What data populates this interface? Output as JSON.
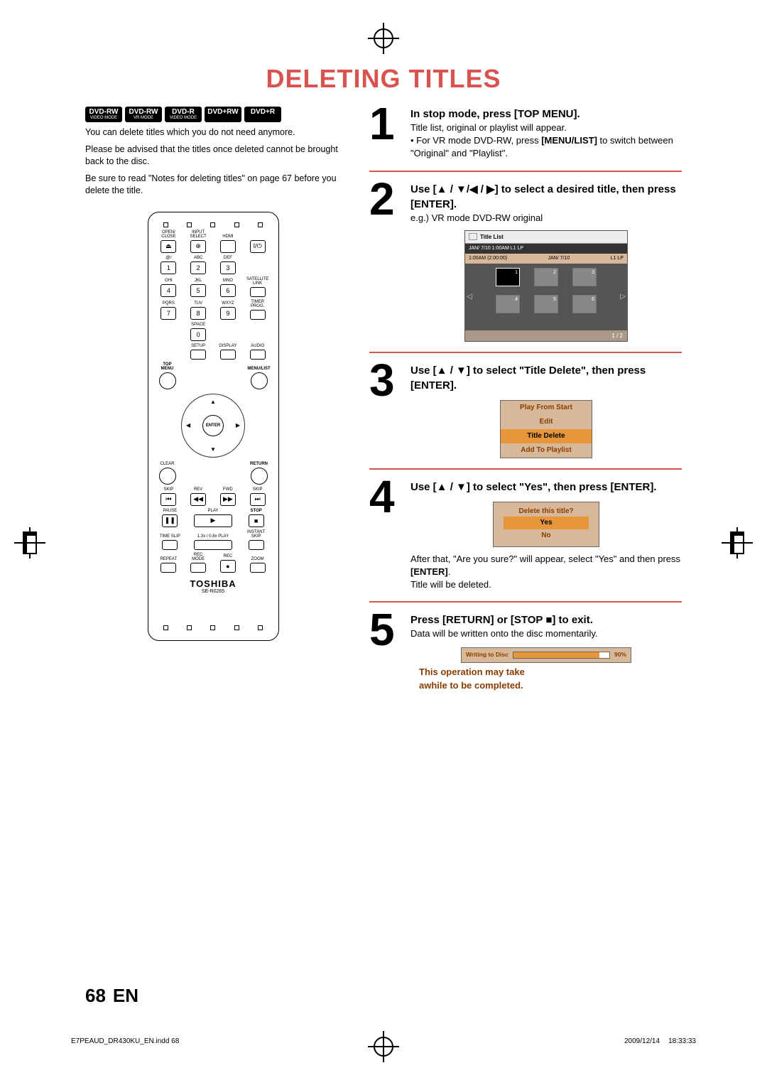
{
  "header": {
    "title": "DELETING TITLES"
  },
  "badges": [
    {
      "top": "DVD-RW",
      "bot": "VIDEO MODE"
    },
    {
      "top": "DVD-RW",
      "bot": "VR MODE"
    },
    {
      "top": "DVD-R",
      "bot": "VIDEO MODE"
    },
    {
      "top": "DVD+RW",
      "bot": ""
    },
    {
      "top": "DVD+R",
      "bot": ""
    }
  ],
  "intro": {
    "p1": "You can delete titles which you do not need anymore.",
    "p2": "Please be advised that the titles once deleted cannot be brought back to the disc.",
    "p3": "Be sure to read \"Notes for deleting titles\" on page 67 before you delete the title."
  },
  "remote": {
    "row1": [
      "OPEN/\nCLOSE",
      "INPUT\nSELECT",
      "HDMI",
      ""
    ],
    "numpad_labels": [
      ".@/:",
      "ABC",
      "DEF",
      "GHI",
      "JKL",
      "MNO",
      "PQRS",
      "TUV",
      "WXYZ",
      "",
      "SPACE",
      ""
    ],
    "numbers": [
      "1",
      "2",
      "3",
      "4",
      "5",
      "6",
      "7",
      "8",
      "9",
      "",
      "0",
      ""
    ],
    "side_labels": [
      "SATELLITE\nLINK",
      "TIMER\nPROG."
    ],
    "row_setup": [
      "SETUP",
      "DISPLAY",
      "AUDIO"
    ],
    "top_menu": "TOP MENU",
    "menu_list": "MENU/LIST",
    "clear": "CLEAR",
    "ret": "RETURN",
    "enter": "ENTER",
    "transport": {
      "skip_l": "SKIP",
      "rev": "REV",
      "fwd": "FWD",
      "skip_r": "SKIP",
      "pause": "PAUSE",
      "play": "PLAY",
      "stop": "STOP",
      "timeslip": "TIME SLIP",
      "x": "1.3x / 0.8x PLAY",
      "instant": "INSTANT SKIP",
      "repeat": "REPEAT",
      "recmode": "REC MODE",
      "rec": "REC",
      "zoom": "ZOOM"
    },
    "brand": "TOSHIBA",
    "model": "SE-R0265"
  },
  "steps": [
    {
      "num": "1",
      "heading": "In stop mode, press [TOP MENU].",
      "lines": [
        "Title list, original or playlist will appear.",
        "For VR mode DVD-RW, press <b>[MENU/LIST]</b> to switch between \"Original\" and \"Playlist\"."
      ]
    },
    {
      "num": "2",
      "heading": "Use [▲ / ▼/◀ / ▶] to select a desired title, then press [ENTER].",
      "sub": "e.g.) VR mode DVD-RW original",
      "titlelist": {
        "head": "Title List",
        "info": "JAN/ 7/10  1:00AM  L1   LP",
        "sub_l": "1:00AM (2:00:00)",
        "sub_c": "JAN/ 7/10",
        "sub_r": "L1   LP",
        "thumbs": [
          "1",
          "2",
          "3",
          "4",
          "5",
          "6"
        ],
        "foot": "1 / 2"
      }
    },
    {
      "num": "3",
      "heading": "Use [▲ / ▼] to select \"Title Delete\", then press [ENTER].",
      "menu": {
        "items": [
          "Play From Start",
          "Edit",
          "Title Delete",
          "Add To Playlist"
        ],
        "selected": 2
      }
    },
    {
      "num": "4",
      "heading": "Use [▲ / ▼] to select \"Yes\", then press [ENTER].",
      "dialog": {
        "prompt": "Delete this title?",
        "yes": "Yes",
        "no": "No"
      },
      "after": "After that, \"Are you sure?\" will appear, select \"Yes\" and then press <b>[ENTER]</b>.",
      "after2": "Title will be deleted."
    },
    {
      "num": "5",
      "heading": "Press [RETURN] or [STOP ■] to exit.",
      "sub": "Data will be written onto the disc momentarily.",
      "write": {
        "label": "Writing to Disc",
        "pct": "90%"
      },
      "warn1": "This operation may take",
      "warn2": "awhile to be completed."
    }
  ],
  "page": {
    "num": "68",
    "lang": "EN"
  },
  "print": {
    "file": "E7PEAUD_DR430KU_EN.indd   68",
    "date": "2009/12/14",
    "time": "18:33:33"
  }
}
